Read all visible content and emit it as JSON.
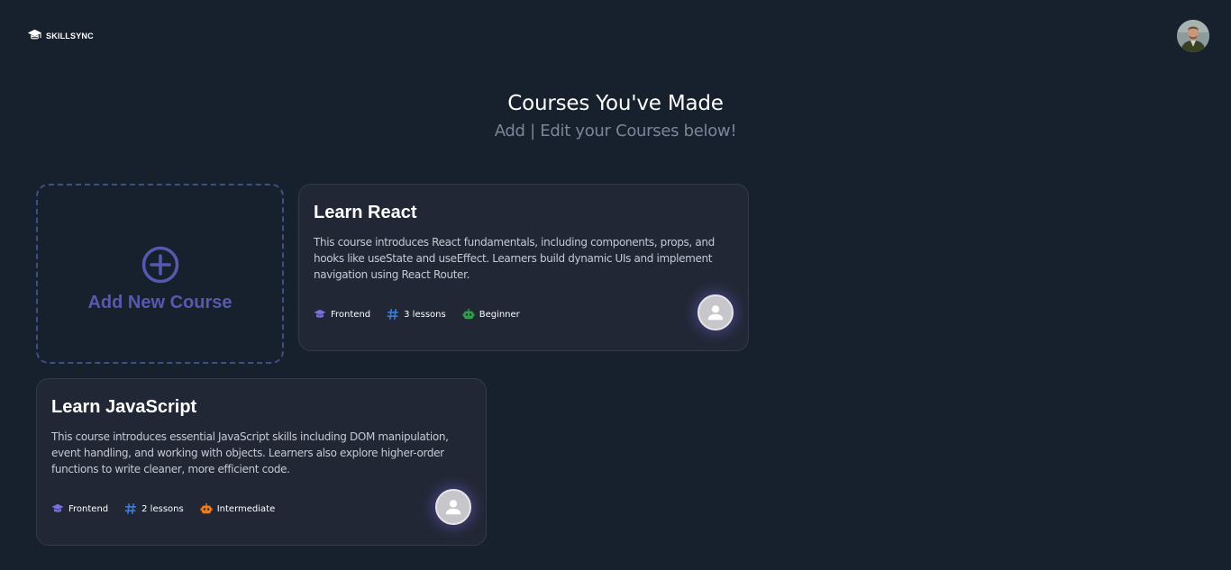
{
  "header": {
    "brand": "SKILLSYNC",
    "logo_icon": "graduation-cap-icon"
  },
  "hero": {
    "title": "Courses You've Made",
    "subtitle": "Add | Edit your Courses below!"
  },
  "add_card": {
    "label": "Add New Course",
    "icon": "plus-circle-icon"
  },
  "courses": [
    {
      "title": "Learn React",
      "description": "This course introduces React fundamentals, including components, props, and hooks like useState and useEffect. Learners build dynamic UIs and implement navigation using React Router.",
      "category": "Frontend",
      "lessons": "3 lessons",
      "level": "Beginner",
      "level_color": "#2e9e4a"
    },
    {
      "title": "Learn JavaScript",
      "description": "This course introduces essential JavaScript skills including DOM manipulation, event handling, and working with objects. Learners also explore higher-order functions to write cleaner, more efficient code.",
      "category": "Frontend",
      "lessons": "2 lessons",
      "level": "Intermediate",
      "level_color": "#f07a1a"
    }
  ],
  "colors": {
    "background": "#17212e",
    "card": "#222735",
    "accent": "#5659ad",
    "category_icon": "#7b6fe0",
    "lessons_icon": "#3b7bd9"
  }
}
